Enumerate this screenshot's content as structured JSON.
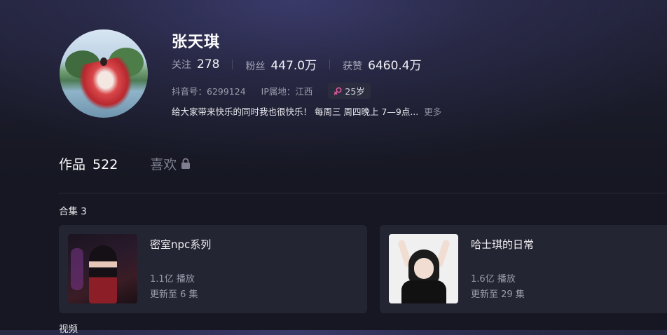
{
  "profile": {
    "name": "张天琪",
    "stats": [
      {
        "label": "关注",
        "value": "278"
      },
      {
        "label": "粉丝",
        "value": "447.0万"
      },
      {
        "label": "获赞",
        "value": "6460.4万"
      }
    ],
    "douyin_id": "抖音号：6299124",
    "ip_location": "IP属地：江西",
    "age": "25岁",
    "bio": "给大家带来快乐的同时我也很快乐！ 每周三 周四晚上 7—9点...",
    "bio_more": "更多"
  },
  "tabs": {
    "works_label": "作品",
    "works_count": "522",
    "likes_label": "喜欢"
  },
  "collections": {
    "title": "合集 3",
    "items": [
      {
        "title": "密室npc系列",
        "plays": "1.1亿 播放",
        "update": "更新至 6 集"
      },
      {
        "title": "哈士琪的日常",
        "plays": "1.6亿 播放",
        "update": "更新至 29 集"
      }
    ]
  },
  "videos": {
    "title": "视频"
  },
  "colors": {
    "background": "#161722",
    "card": "#242532",
    "badge_icon": "#e25aa0"
  },
  "icons": {
    "age_badge": "female-icon",
    "likes_tab": "lock-icon"
  }
}
